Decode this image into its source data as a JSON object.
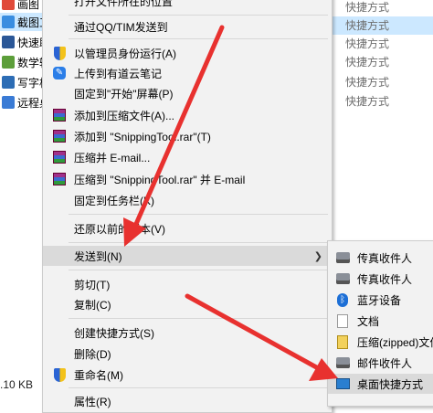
{
  "explorer": {
    "items": [
      {
        "label": "画图",
        "color": "#e04a3a",
        "selected": false
      },
      {
        "label": "截图工",
        "color": "#3a8de0",
        "selected": true
      },
      {
        "label": "快速助",
        "color": "#2b5797",
        "selected": false
      },
      {
        "label": "数学输",
        "color": "#5c9e3a",
        "selected": false
      },
      {
        "label": "写字板",
        "color": "#2d6db5",
        "selected": false
      },
      {
        "label": "远程桌",
        "color": "#3a7bd5",
        "selected": false
      }
    ],
    "status_size": ".10 KB"
  },
  "type_column": {
    "items": [
      "快捷方式",
      "快捷方式",
      "快捷方式",
      "快捷方式",
      "快捷方式",
      "快捷方式"
    ]
  },
  "context_menu": {
    "items": [
      {
        "label": "打开文件所在的位置",
        "icon": "none"
      },
      {
        "label": "通过QQ/TIM发送到",
        "icon": "none"
      },
      {
        "label": "以管理员身份运行(A)",
        "icon": "uac-shield-icon"
      },
      {
        "label": "上传到有道云笔记",
        "icon": "youdao-note-icon"
      },
      {
        "label": "固定到\"开始\"屏幕(P)",
        "icon": "none"
      },
      {
        "label": "添加到压缩文件(A)...",
        "icon": "winrar-icon"
      },
      {
        "label": "添加到 \"SnippingTool.rar\"(T)",
        "icon": "winrar-icon"
      },
      {
        "label": "压缩并 E-mail...",
        "icon": "winrar-icon"
      },
      {
        "label": "压缩到 \"SnippingTool.rar\" 并 E-mail",
        "icon": "winrar-icon"
      },
      {
        "label": "固定到任务栏(K)",
        "icon": "none"
      },
      {
        "label": "还原以前的版本(V)",
        "icon": "none"
      },
      {
        "label": "发送到(N)",
        "icon": "none"
      },
      {
        "label": "剪切(T)",
        "icon": "none"
      },
      {
        "label": "复制(C)",
        "icon": "none"
      },
      {
        "label": "创建快捷方式(S)",
        "icon": "none"
      },
      {
        "label": "删除(D)",
        "icon": "none"
      },
      {
        "label": "重命名(M)",
        "icon": "uac-shield-icon"
      },
      {
        "label": "属性(R)",
        "icon": "none"
      }
    ],
    "submenu_arrow": "❯"
  },
  "send_to_submenu": {
    "items": [
      {
        "label": "传真收件人",
        "icon": "fax-icon"
      },
      {
        "label": "传真收件人",
        "icon": "fax-icon"
      },
      {
        "label": "蓝牙设备",
        "icon": "bluetooth-icon"
      },
      {
        "label": "文档",
        "icon": "document-icon"
      },
      {
        "label": "压缩(zipped)文件夹",
        "icon": "zip-folder-icon"
      },
      {
        "label": "邮件收件人",
        "icon": "mail-icon"
      },
      {
        "label": "桌面快捷方式",
        "icon": "desktop-icon"
      }
    ]
  },
  "colors": {
    "menu_bg": "#f2f2f2",
    "highlight": "#dadada",
    "selection": "#cce8ff",
    "annotation_arrow": "#e8312f"
  }
}
